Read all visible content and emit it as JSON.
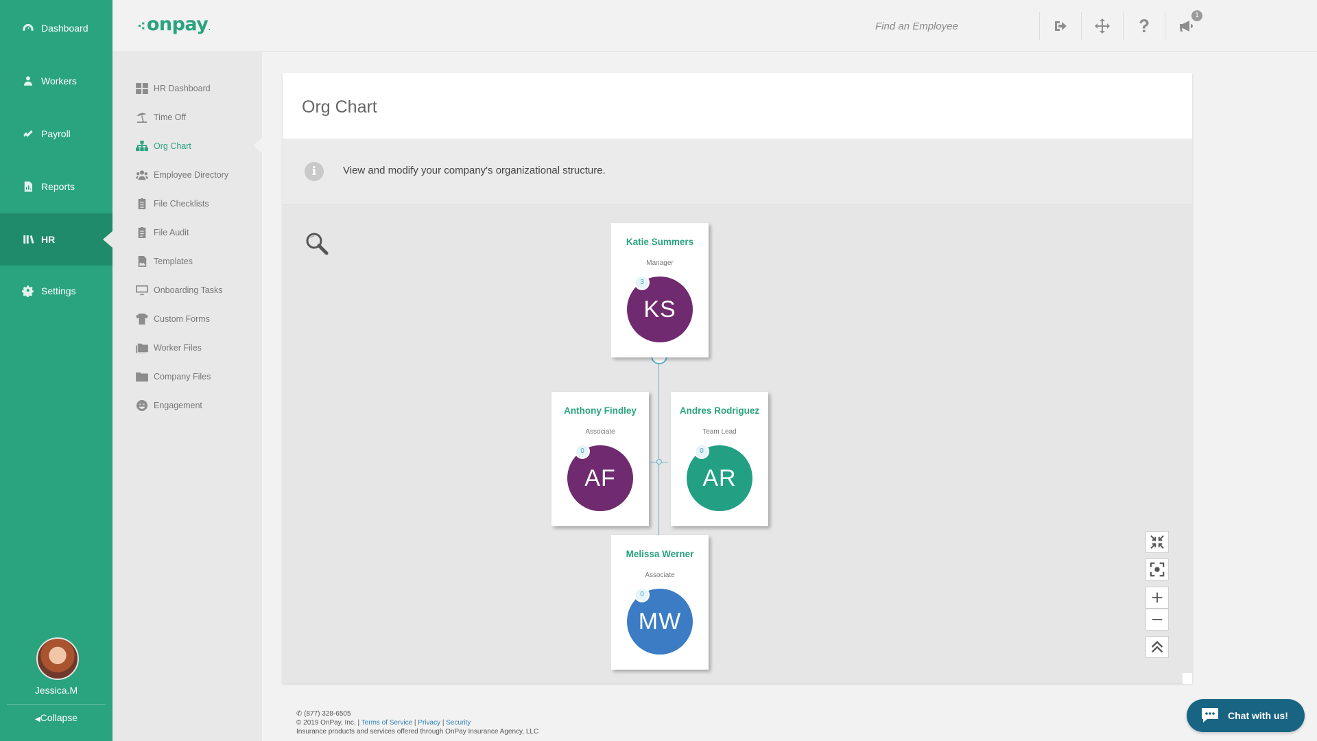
{
  "leftnav": {
    "items": [
      {
        "label": "Dashboard",
        "icon": "gauge-icon"
      },
      {
        "label": "Workers",
        "icon": "worker-icon"
      },
      {
        "label": "Payroll",
        "icon": "payroll-icon"
      },
      {
        "label": "Reports",
        "icon": "report-icon"
      },
      {
        "label": "HR",
        "icon": "hr-icon",
        "active": true
      },
      {
        "label": "Settings",
        "icon": "gear-icon"
      }
    ],
    "user_name": "Jessica.M",
    "collapse_label": "Collapse"
  },
  "header": {
    "logo_text": "onpay",
    "search_placeholder": "Find an Employee",
    "notification_count": "1"
  },
  "submenu": {
    "items": [
      {
        "label": "HR Dashboard",
        "icon": "grid-icon"
      },
      {
        "label": "Time Off",
        "icon": "beach-umbrella-icon"
      },
      {
        "label": "Org Chart",
        "icon": "org-chart-icon",
        "active": true
      },
      {
        "label": "Employee Directory",
        "icon": "people-icon"
      },
      {
        "label": "File Checklists",
        "icon": "clipboard-icon"
      },
      {
        "label": "File Audit",
        "icon": "clipboard-check-icon"
      },
      {
        "label": "Templates",
        "icon": "template-icon"
      },
      {
        "label": "Onboarding Tasks",
        "icon": "monitor-icon"
      },
      {
        "label": "Custom Forms",
        "icon": "shirt-icon"
      },
      {
        "label": "Worker Files",
        "icon": "folders-icon"
      },
      {
        "label": "Company Files",
        "icon": "folder-icon"
      },
      {
        "label": "Engagement",
        "icon": "smile-icon"
      }
    ]
  },
  "main": {
    "title": "Org Chart",
    "info_text": "View and modify your company's organizational structure."
  },
  "org_chart": {
    "employees": [
      {
        "name": "Katie Summers",
        "role": "Manager",
        "initials": "KS",
        "reports": "3",
        "color": "#702a6f"
      },
      {
        "name": "Anthony Findley",
        "role": "Associate",
        "initials": "AF",
        "reports": "0",
        "color": "#702a6f"
      },
      {
        "name": "Andres Rodriguez",
        "role": "Team Lead",
        "initials": "AR",
        "reports": "0",
        "color": "#23a084"
      },
      {
        "name": "Melissa Werner",
        "role": "Associate",
        "initials": "MW",
        "reports": "0",
        "color": "#3b7cc4"
      }
    ]
  },
  "footer": {
    "phone": "(877) 328-6505",
    "copyright": "© 2019 OnPay, Inc. |",
    "terms": "Terms of Service",
    "privacy": "Privacy",
    "security": "Security",
    "insurance": "Insurance products and services offered through OnPay Insurance Agency, LLC"
  },
  "chat": {
    "label": "Chat with us!"
  }
}
